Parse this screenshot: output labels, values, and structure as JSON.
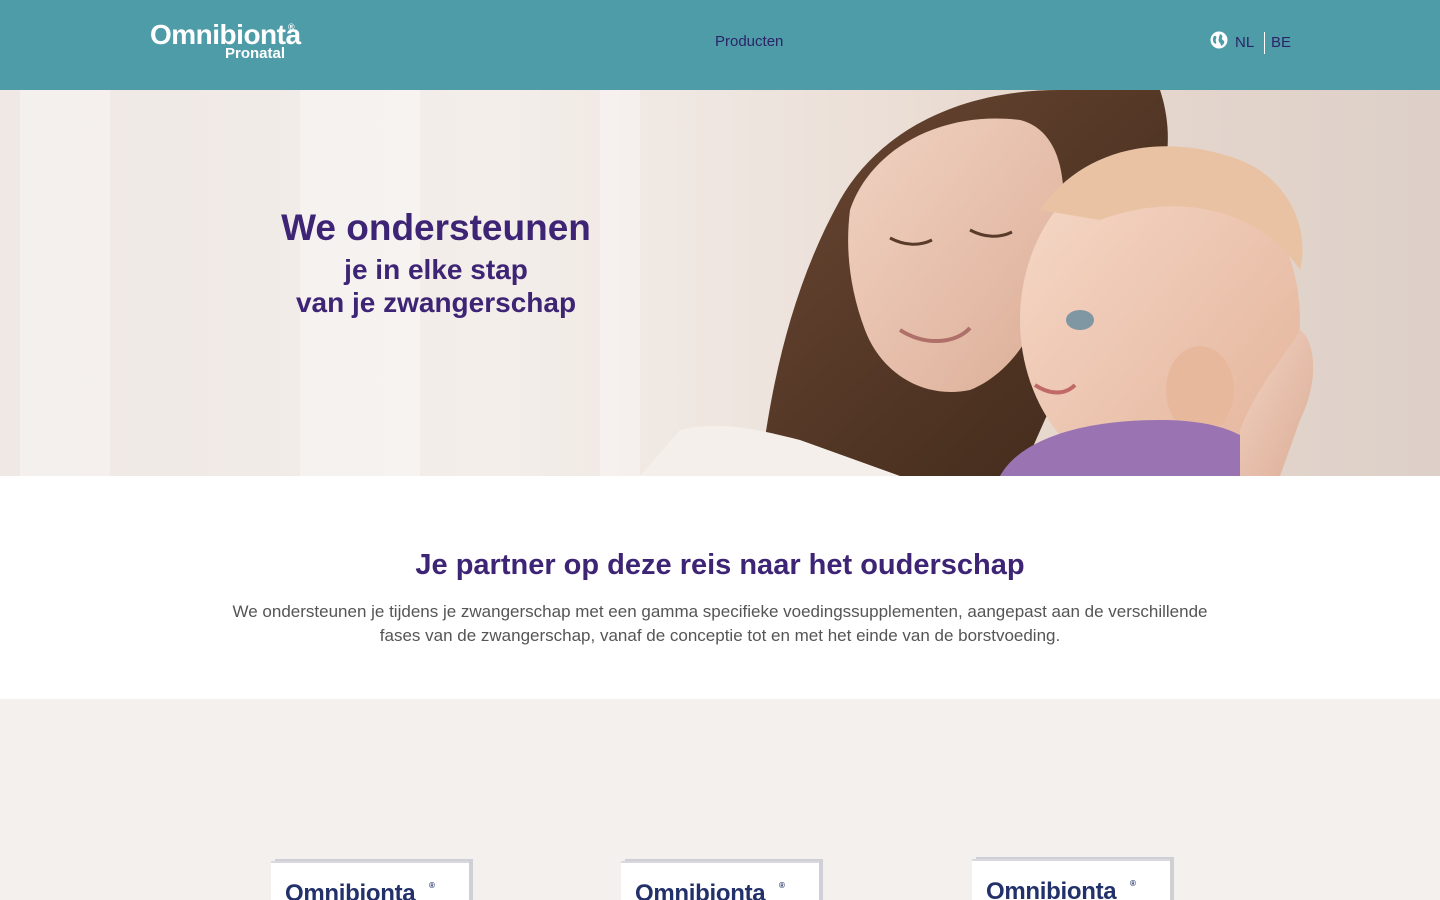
{
  "header": {
    "logo_main": "Omnibionta",
    "logo_reg": "®",
    "logo_sub": "Pronatal",
    "nav_products": "Producten",
    "lang_current": "NL",
    "lang_other": "BE",
    "background_color": "#4f9ca9"
  },
  "hero": {
    "title": "We ondersteunen",
    "subtitle_line1": "je in elke stap",
    "subtitle_line2": "van je zwangerschap",
    "text_color": "#3e2475"
  },
  "intro": {
    "title": "Je partner op deze reis naar het ouderschap",
    "text": "We ondersteunen je tijdens je zwangerschap met een gamma specifieke voedingssupplementen, aangepast aan de verschillende fases van de zwangerschap, vanaf de conceptie tot en met het einde van de borstvoeding."
  },
  "products": {
    "items": [
      {
        "brand": "Omnibionta",
        "reg": "®"
      },
      {
        "brand": "Omnibionta",
        "reg": "®"
      },
      {
        "brand": "Omnibionta",
        "reg": "®"
      }
    ],
    "background_color": "#f3f0ed"
  }
}
